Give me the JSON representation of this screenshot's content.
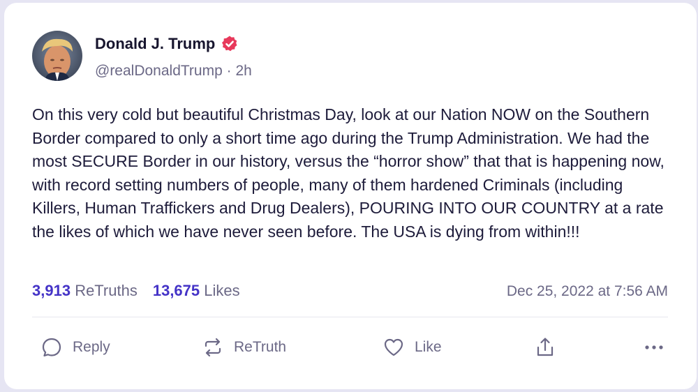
{
  "post": {
    "author_name": "Donald J. Trump",
    "handle": "@realDonaldTrump",
    "separator": "·",
    "time_ago": "2h",
    "text": "On this very cold but beautiful Christmas Day, look at our Nation NOW on the Southern Border compared to only a short time ago during the Trump Administration. We had the most SECURE Border in our history, versus the “horror show” that that is happening now, with record setting numbers of people, many of them hardened Criminals (including Killers, Human Traffickers and Drug Dealers), POURING INTO OUR COUNTRY at a rate the likes of which we have never seen before. The USA is dying from within!!!",
    "retruths_count": "3,913",
    "retruths_label": "ReTruths",
    "likes_count": "13,675",
    "likes_label": "Likes",
    "timestamp": "Dec 25, 2022 at 7:56 AM"
  },
  "actions": {
    "reply": "Reply",
    "retruth": "ReTruth",
    "like": "Like"
  },
  "colors": {
    "accent": "#4433c7",
    "verified_badge": "#e8395b",
    "muted_text": "#6b6886",
    "background": "#e6e5f3"
  },
  "icons": [
    "verified-badge-icon",
    "reply-icon",
    "retruth-icon",
    "like-icon",
    "share-icon",
    "more-icon"
  ]
}
